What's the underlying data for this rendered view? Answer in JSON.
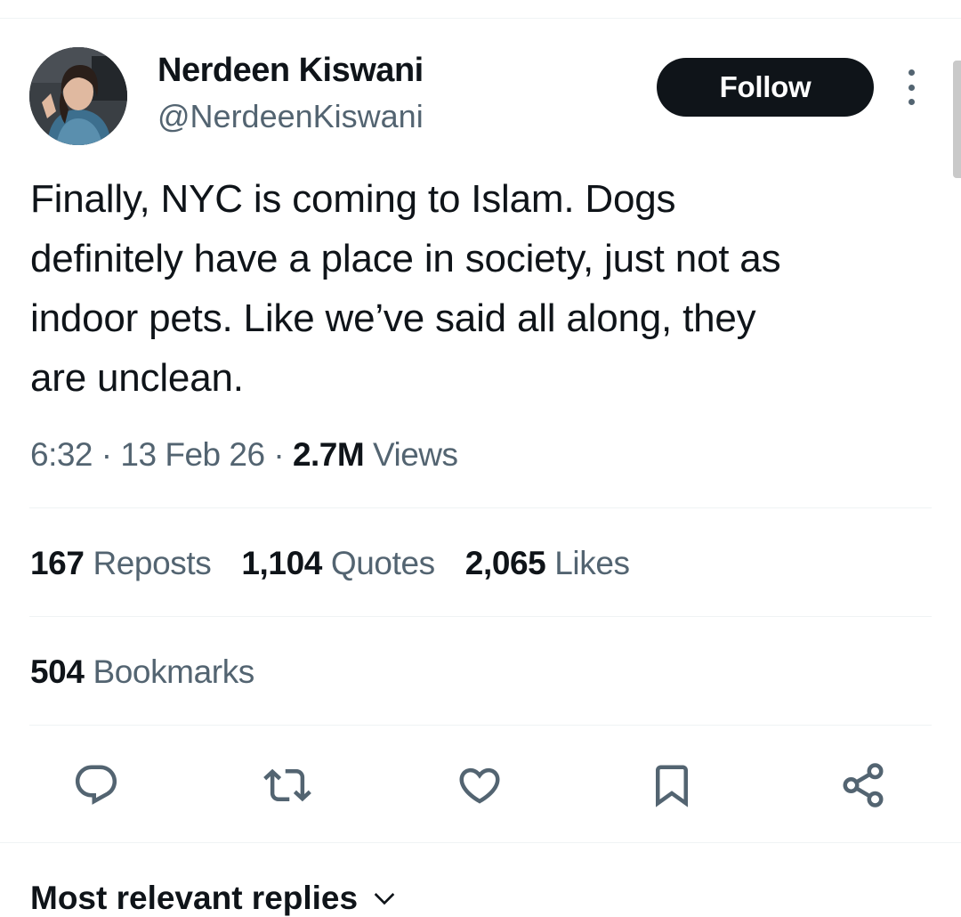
{
  "author": {
    "display_name": "Nerdeen Kiswani",
    "handle": "@NerdeenKiswani",
    "avatar_icon": "profile-photo"
  },
  "follow_label": "Follow",
  "more_icon": "more-vertical-icon",
  "tweet": {
    "text": "Finally, NYC is coming to Islam. Dogs\ndefinitely have a place in society, just not as\nindoor pets. Like we’ve said all along, they\nare unclean.",
    "time": "6:32",
    "separator": "·",
    "date": "13 Feb 26",
    "views_count": "2.7M",
    "views_label": "Views"
  },
  "stats": {
    "reposts": {
      "count": "167",
      "label": "Reposts"
    },
    "quotes": {
      "count": "1,104",
      "label": "Quotes"
    },
    "likes": {
      "count": "2,065",
      "label": "Likes"
    },
    "bookmarks": {
      "count": "504",
      "label": "Bookmarks"
    }
  },
  "actions": [
    "reply-icon",
    "repost-icon",
    "like-icon",
    "bookmark-icon",
    "share-icon"
  ],
  "replies_header": "Most relevant replies",
  "colors": {
    "text_primary": "#0f1419",
    "text_secondary": "#536471",
    "divider": "#eff3f4",
    "button_bg": "#0f1419"
  }
}
